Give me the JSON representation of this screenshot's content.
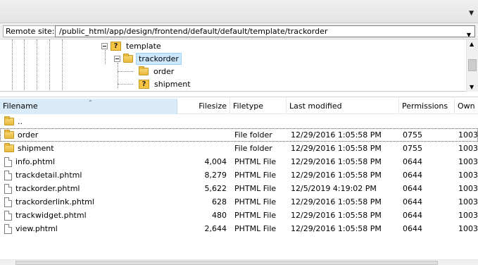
{
  "site": {
    "label": "Remote site:",
    "path": "/public_html/app/design/frontend/default/default/template/trackorder"
  },
  "tree": {
    "nodes": [
      {
        "label": "template",
        "icon": "question-folder-icon"
      },
      {
        "label": "trackorder",
        "icon": "folder-icon",
        "selected": true
      },
      {
        "label": "order",
        "icon": "folder-icon"
      },
      {
        "label": "shipment",
        "icon": "question-folder-icon"
      }
    ]
  },
  "columns": {
    "filename": "Filename",
    "filesize": "Filesize",
    "filetype": "Filetype",
    "modified": "Last modified",
    "permissions": "Permissions",
    "owner": "Own"
  },
  "rows": [
    {
      "name": "..",
      "size": "",
      "type": "",
      "modified": "",
      "perms": "",
      "owner": "",
      "icon": "folder-icon"
    },
    {
      "name": "order",
      "size": "",
      "type": "File folder",
      "modified": "12/29/2016 1:05:58 PM",
      "perms": "0755",
      "owner": "1003",
      "icon": "folder-icon"
    },
    {
      "name": "shipment",
      "size": "",
      "type": "File folder",
      "modified": "12/29/2016 1:05:58 PM",
      "perms": "0755",
      "owner": "1003",
      "icon": "folder-icon"
    },
    {
      "name": "info.phtml",
      "size": "4,004",
      "type": "PHTML File",
      "modified": "12/29/2016 1:05:58 PM",
      "perms": "0644",
      "owner": "1003",
      "icon": "file-icon"
    },
    {
      "name": "trackdetail.phtml",
      "size": "8,279",
      "type": "PHTML File",
      "modified": "12/29/2016 1:05:58 PM",
      "perms": "0644",
      "owner": "1003",
      "icon": "file-icon"
    },
    {
      "name": "trackorder.phtml",
      "size": "5,622",
      "type": "PHTML File",
      "modified": "12/5/2019 4:19:02 PM",
      "perms": "0644",
      "owner": "1003",
      "icon": "file-icon"
    },
    {
      "name": "trackorderlink.phtml",
      "size": "628",
      "type": "PHTML File",
      "modified": "12/29/2016 1:05:58 PM",
      "perms": "0644",
      "owner": "1003",
      "icon": "file-icon"
    },
    {
      "name": "trackwidget.phtml",
      "size": "480",
      "type": "PHTML File",
      "modified": "12/29/2016 1:05:58 PM",
      "perms": "0644",
      "owner": "1003",
      "icon": "file-icon"
    },
    {
      "name": "view.phtml",
      "size": "2,644",
      "type": "PHTML File",
      "modified": "12/29/2016 1:05:58 PM",
      "perms": "0644",
      "owner": "1003",
      "icon": "file-icon"
    }
  ],
  "colors": {
    "selection": "#cce8ff",
    "sorted_header": "#d9ebf9",
    "folder": "#e9b93b"
  }
}
